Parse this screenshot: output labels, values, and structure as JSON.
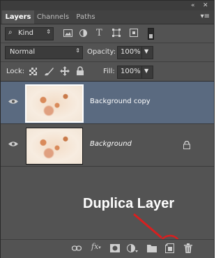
{
  "tabs": [
    {
      "label": "Layers",
      "active": true
    },
    {
      "label": "Channels",
      "active": false
    },
    {
      "label": "Paths",
      "active": false
    }
  ],
  "filter": {
    "kind_label": "Kind"
  },
  "blend": {
    "mode": "Normal",
    "opacity_label": "Opacity:",
    "opacity_value": "100%"
  },
  "lock": {
    "label": "Lock:",
    "fill_label": "Fill:",
    "fill_value": "100%"
  },
  "layers": [
    {
      "name": "Background copy",
      "selected": true
    },
    {
      "name": "Background",
      "selected": false,
      "locked": true
    }
  ],
  "annotation": {
    "text": "Duplica Layer",
    "color": "#d91f1f"
  },
  "colors": {
    "panel": "#535353",
    "selection": "#5a6a80",
    "annotation_red": "#d91f1f"
  }
}
